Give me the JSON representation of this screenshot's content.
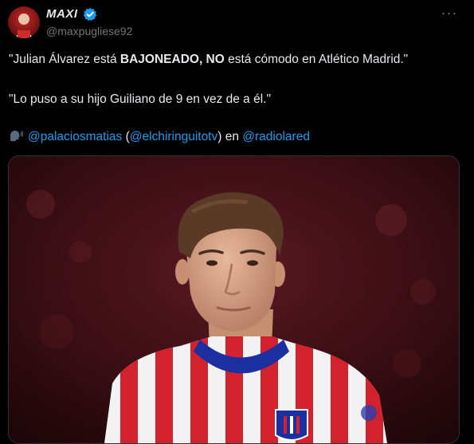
{
  "author": {
    "display_name": "MAXI",
    "handle": "@maxpugliese92"
  },
  "tweet": {
    "line1": {
      "part1": "\"Julian Álvarez está ",
      "bold1": "BAJONEADO, NO",
      "part2": " está cómodo en Atlético Madrid.\""
    },
    "line2": "\"Lo puso a su hijo Guiliano de 9 en vez de a él.\"",
    "line3": {
      "mention1": "@palaciosmatias",
      "paren_open": " (",
      "mention2": "@elchiringuitotv",
      "paren_close": ") en ",
      "mention3": "@radiolared"
    }
  },
  "icons": {
    "avatar": "avatar-image",
    "verified": "verified-badge-icon",
    "more": "more-options-icon",
    "speaker": "speaking-head-icon"
  },
  "colors": {
    "background": "#000000",
    "text": "#e7e9ea",
    "muted": "#71767b",
    "link": "#1d9bf0",
    "verified": "#1d9bf0"
  }
}
